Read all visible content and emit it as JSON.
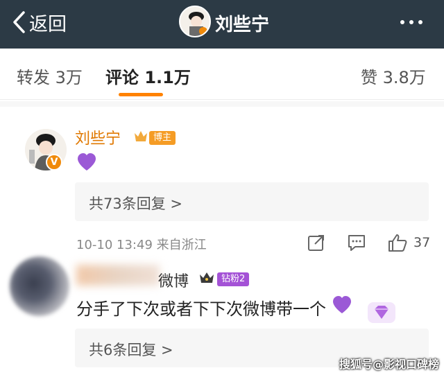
{
  "header": {
    "back_label": "返回",
    "title": "刘些宁",
    "more_icon": "more-dots-icon"
  },
  "tabs": [
    {
      "label": "转发 3万"
    },
    {
      "label": "评论 1.1万",
      "active": true
    },
    {
      "label": "赞 3.8万"
    }
  ],
  "accent_color": "#ff8200",
  "comments": [
    {
      "author": "刘些宁",
      "badge": "博主",
      "text_emoji": "purple-heart",
      "replies_label": "共73条回复 >",
      "time_location": "10-10 13:49 来自浙江",
      "likes": "37"
    },
    {
      "author_visible_suffix": "微博",
      "badge": "钻粉2",
      "text": "分手了下次或者下下次微博带一个",
      "replies_label": "共6条回复 >"
    }
  ],
  "watermark": "搜狐号@影视口碑榜"
}
